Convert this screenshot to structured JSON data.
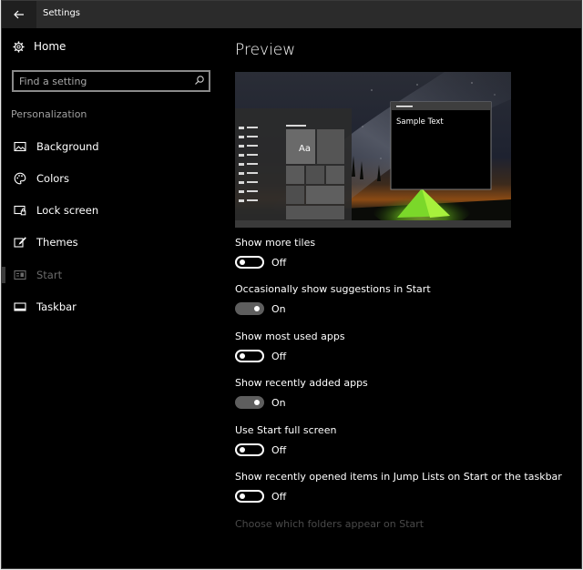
{
  "window": {
    "title": "Settings"
  },
  "sidebar": {
    "home_label": "Home",
    "search_placeholder": "Find a setting",
    "section_label": "Personalization",
    "items": [
      {
        "label": "Background",
        "icon": "picture-icon"
      },
      {
        "label": "Colors",
        "icon": "palette-icon"
      },
      {
        "label": "Lock screen",
        "icon": "lock-screen-icon"
      },
      {
        "label": "Themes",
        "icon": "brush-icon"
      },
      {
        "label": "Start",
        "icon": "start-icon",
        "selected": true
      },
      {
        "label": "Taskbar",
        "icon": "taskbar-icon"
      }
    ]
  },
  "main": {
    "preview_title": "Preview",
    "preview": {
      "tile_label": "Aa",
      "sample_text": "Sample Text"
    },
    "settings": [
      {
        "label": "Show more tiles",
        "state": "Off",
        "on": false
      },
      {
        "label": "Occasionally show suggestions in Start",
        "state": "On",
        "on": true
      },
      {
        "label": "Show most used apps",
        "state": "Off",
        "on": false
      },
      {
        "label": "Show recently added apps",
        "state": "On",
        "on": true
      },
      {
        "label": "Use Start full screen",
        "state": "Off",
        "on": false
      },
      {
        "label": "Show recently opened items in Jump Lists on Start or the taskbar",
        "state": "Off",
        "on": false
      }
    ],
    "folders_link": "Choose which folders appear on Start"
  },
  "colors": {
    "background": "#000000",
    "titlebar": "#2b2b2b",
    "toggle_on": "#5e5e5e",
    "disabled_text": "#4a4a4a"
  }
}
